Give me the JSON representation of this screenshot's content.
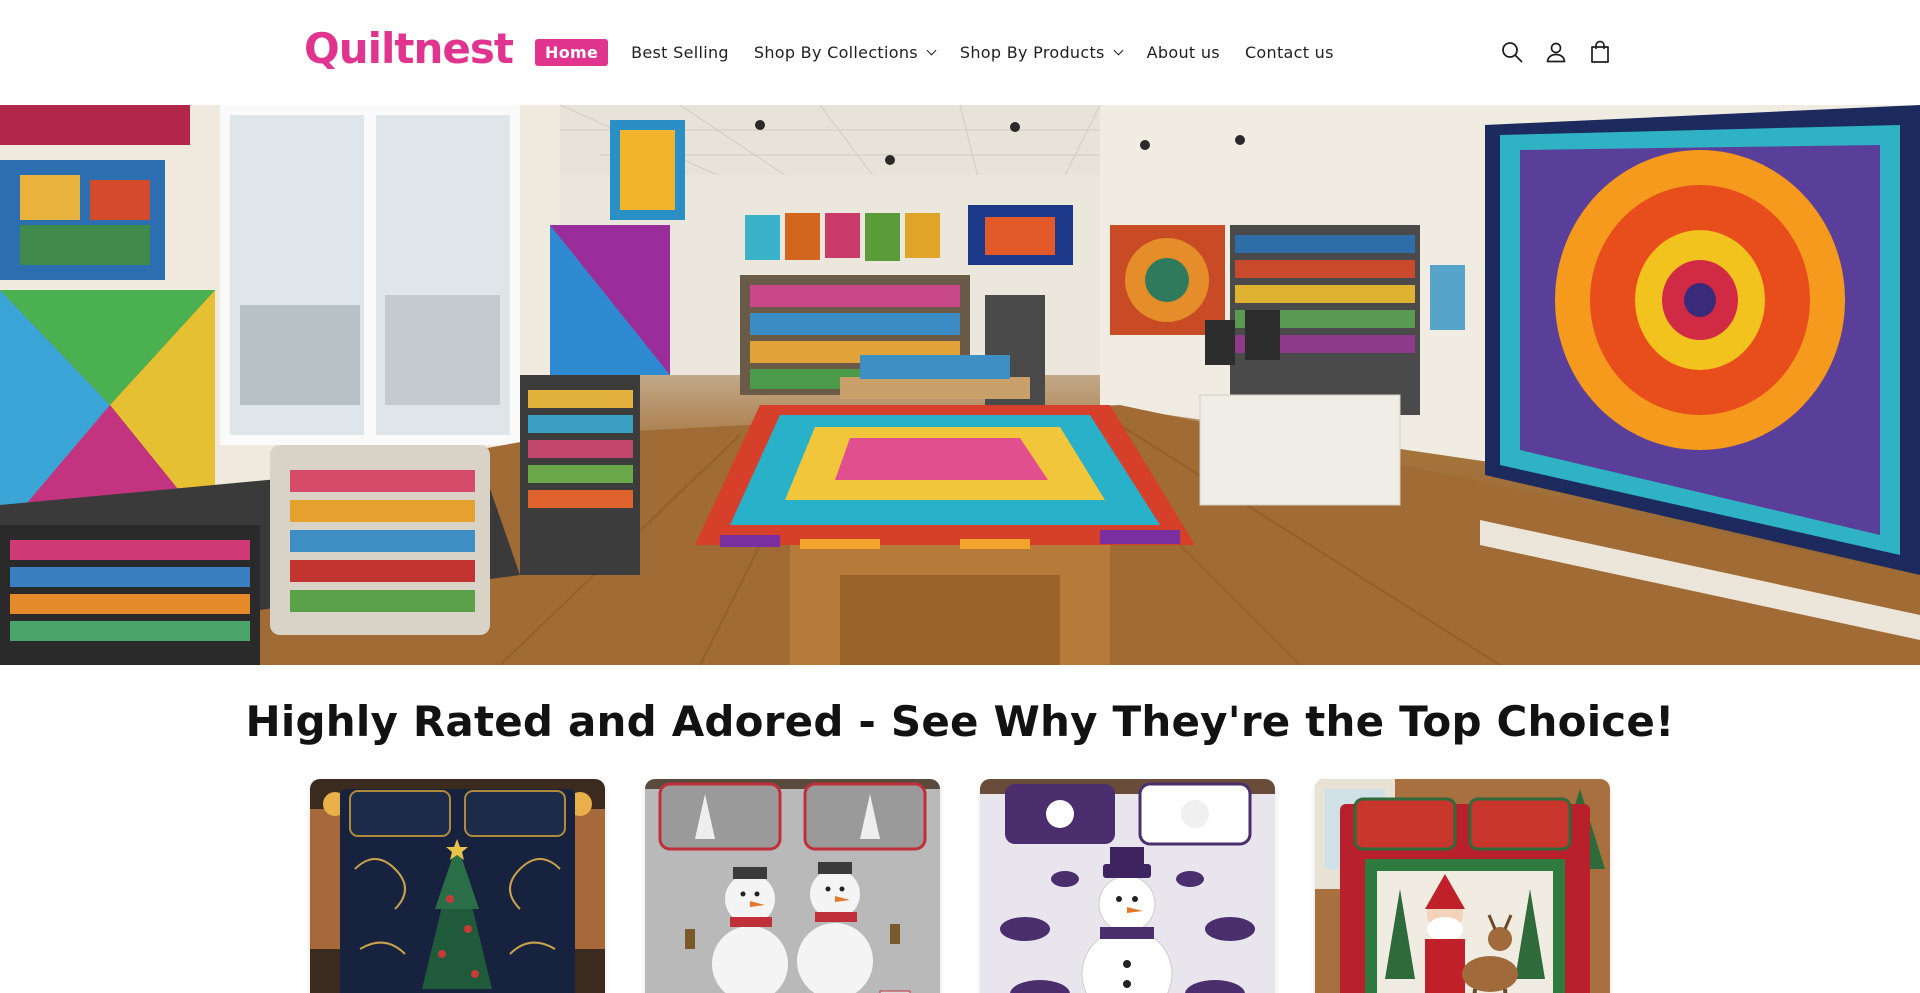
{
  "brand": {
    "name": "Quiltnest",
    "color": "#e0348e"
  },
  "nav": {
    "items": [
      {
        "label": "Home",
        "active": true,
        "dropdown": false
      },
      {
        "label": "Best Selling",
        "active": false,
        "dropdown": false
      },
      {
        "label": "Shop By Collections",
        "active": false,
        "dropdown": true
      },
      {
        "label": "Shop By Products",
        "active": false,
        "dropdown": true
      },
      {
        "label": "About us",
        "active": false,
        "dropdown": false
      },
      {
        "label": "Contact us",
        "active": false,
        "dropdown": false
      }
    ]
  },
  "header_icons": [
    "search-icon",
    "account-icon",
    "cart-icon"
  ],
  "hero": {
    "image": "quilt-shop-interior"
  },
  "section": {
    "title": "Highly Rated and Adored - See Why They're the Top Choice!"
  },
  "products": [
    {
      "image": "christmas-tree-navy-quilt-bedding"
    },
    {
      "image": "snowman-couple-gray-quilt-bedding"
    },
    {
      "image": "purple-snowman-quilt-bedding"
    },
    {
      "image": "santa-reindeer-red-quilt-bedding"
    }
  ]
}
